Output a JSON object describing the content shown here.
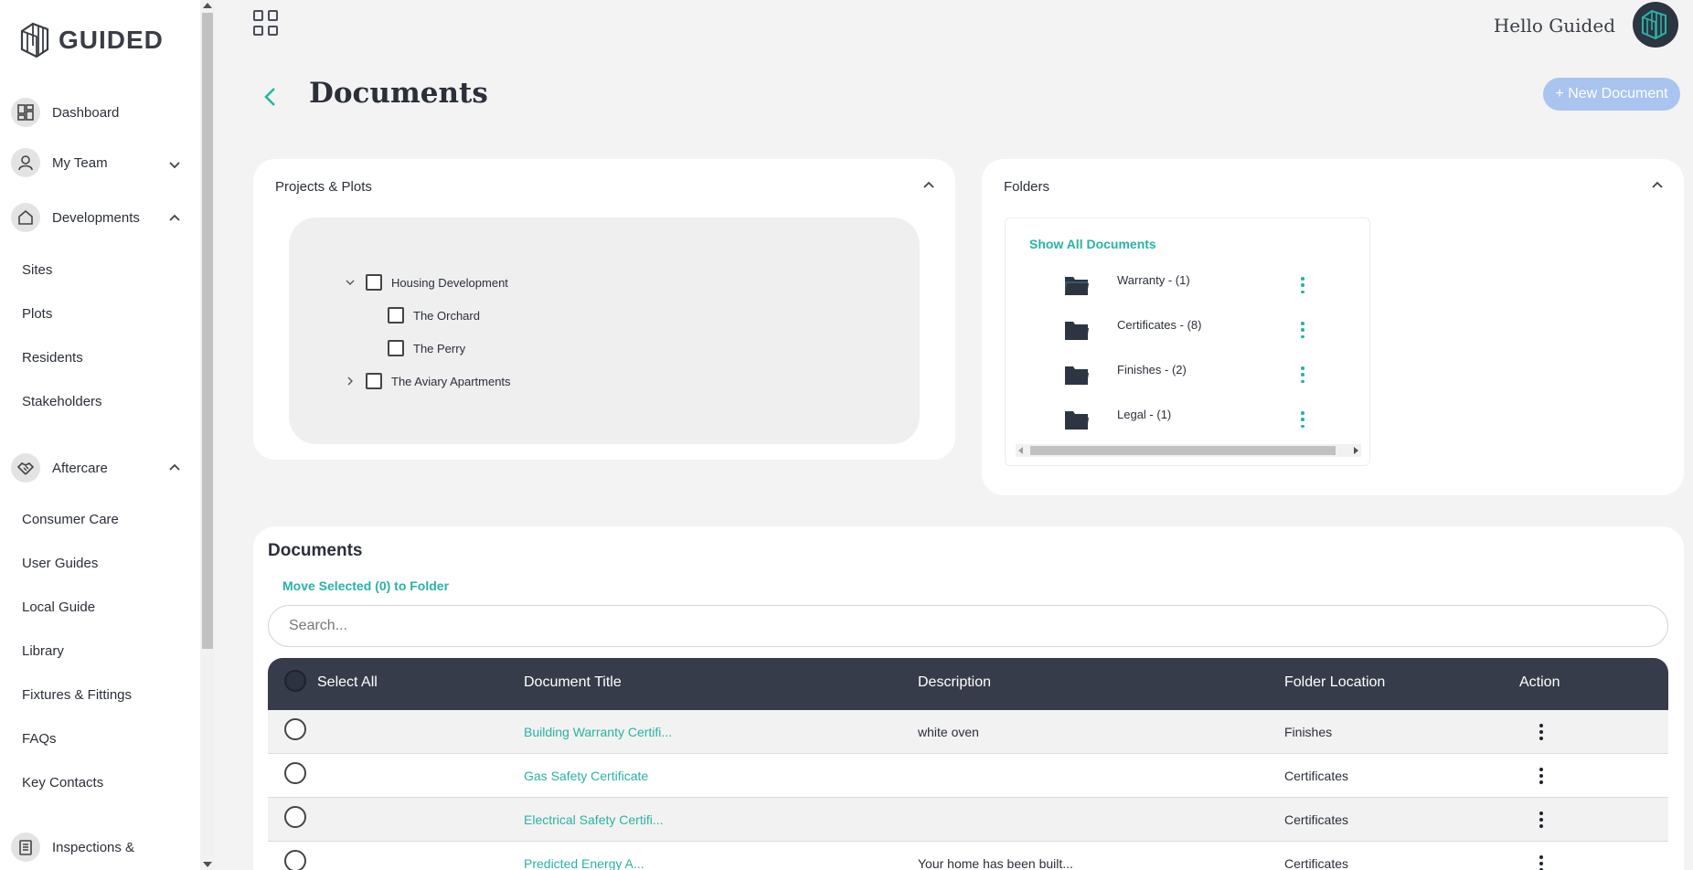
{
  "brand": {
    "name": "GUIDED"
  },
  "header": {
    "greeting": "Hello Guided"
  },
  "sidebar": {
    "main_items": [
      {
        "label": "Dashboard",
        "icon": "dashboard-icon"
      },
      {
        "label": "My Team",
        "icon": "user-icon",
        "expanded": false
      },
      {
        "label": "Developments",
        "icon": "home-icon",
        "expanded": true
      },
      {
        "label": "Aftercare",
        "icon": "handshake-icon",
        "expanded": true
      },
      {
        "label": "Inspections &",
        "icon": "clipboard-icon"
      }
    ],
    "developments_sub": [
      "Sites",
      "Plots",
      "Residents",
      "Stakeholders"
    ],
    "aftercare_sub": [
      "Consumer Care",
      "User Guides",
      "Local Guide",
      "Library",
      "Fixtures & Fittings",
      "FAQs",
      "Key Contacts"
    ]
  },
  "page": {
    "title": "Documents",
    "new_button": "+ New Document"
  },
  "projects_panel": {
    "title": "Projects & Plots",
    "tree": [
      {
        "label": "Housing Development",
        "expanded": true
      },
      {
        "label": "The Orchard"
      },
      {
        "label": "The Perry"
      },
      {
        "label": "The Aviary Apartments",
        "expanded": false
      }
    ]
  },
  "folders_panel": {
    "title": "Folders",
    "show_all": "Show All Documents",
    "folders": [
      "Warranty - (1)",
      "Certificates - (8)",
      "Finishes - (2)",
      "Legal - (1)"
    ]
  },
  "documents": {
    "title": "Documents",
    "move_selected": "Move Selected (0) to Folder",
    "search_placeholder": "Search...",
    "columns": [
      "Select All",
      "Document Title",
      "Description",
      "Folder Location",
      "Action"
    ],
    "rows": [
      {
        "title": "Building Warranty Certifi...",
        "description": "white oven",
        "folder": "Finishes"
      },
      {
        "title": "Gas Safety Certificate",
        "description": "",
        "folder": "Certificates"
      },
      {
        "title": "Electrical Safety Certifi...",
        "description": "",
        "folder": "Certificates"
      },
      {
        "title": "Predicted Energy A...",
        "description": "Your home has been built...",
        "folder": "Certificates"
      }
    ]
  },
  "colors": {
    "accent": "#29b3a4",
    "header_dark": "#373c4a",
    "new_button": "#a9c4ef"
  }
}
